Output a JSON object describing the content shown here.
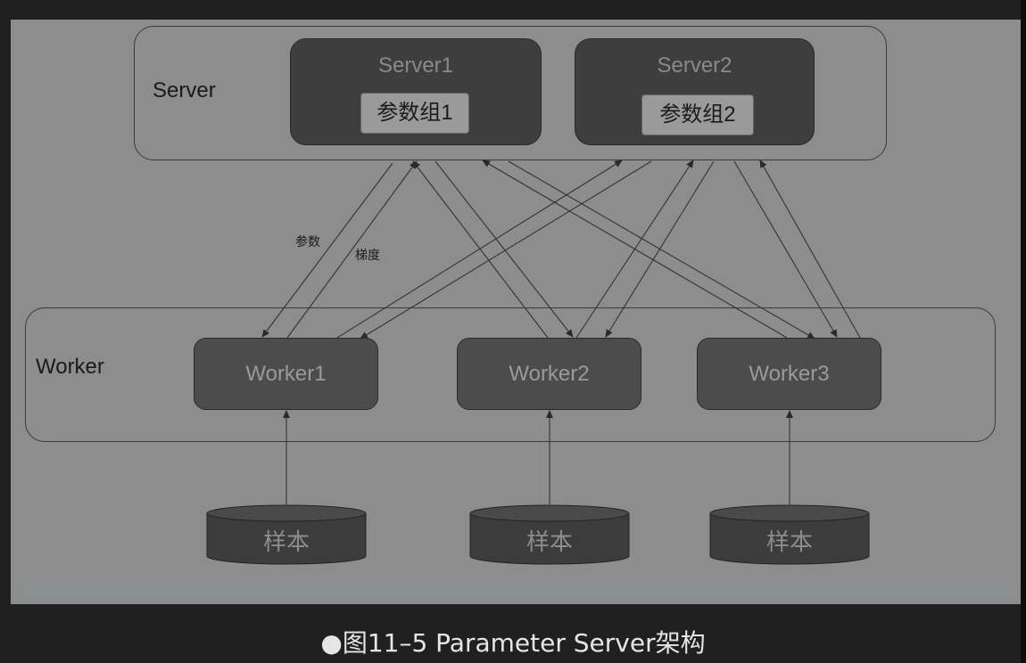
{
  "groups": {
    "server_label": "Server",
    "worker_label": "Worker"
  },
  "servers": [
    {
      "title": "Server1",
      "param": "参数组1"
    },
    {
      "title": "Server2",
      "param": "参数组2"
    }
  ],
  "workers": [
    "Worker1",
    "Worker2",
    "Worker3"
  ],
  "samples": [
    "样本",
    "样本",
    "样本"
  ],
  "edge_labels": {
    "params": "参数",
    "gradient": "梯度"
  },
  "caption": "●图11–5 Parameter Server架构"
}
